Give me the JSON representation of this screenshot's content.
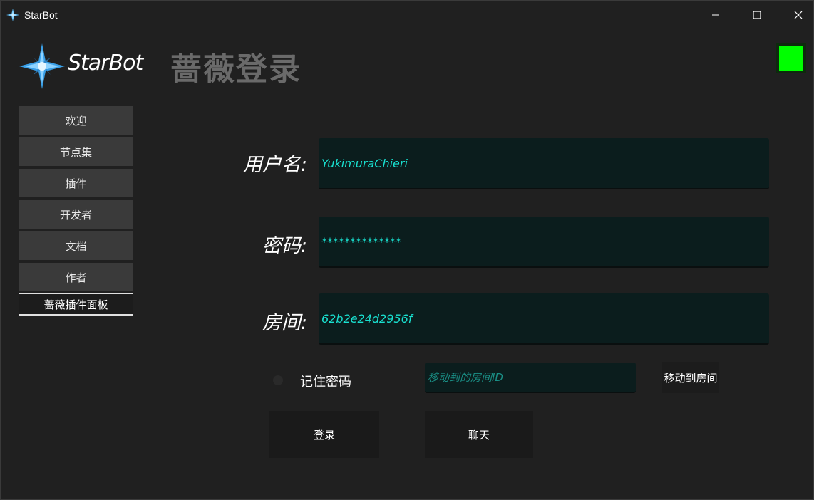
{
  "window": {
    "title": "StarBot",
    "icon": "starbot-icon",
    "controls": [
      "minimize-icon",
      "maximize-icon",
      "close-icon"
    ]
  },
  "sidebar": {
    "logo_text": "StarBot",
    "items": [
      {
        "label": "欢迎"
      },
      {
        "label": "节点集"
      },
      {
        "label": "插件"
      },
      {
        "label": "开发者"
      },
      {
        "label": "文档"
      },
      {
        "label": "作者"
      },
      {
        "label": "蔷薇插件面板",
        "active": true
      }
    ]
  },
  "main": {
    "title": "蔷薇登录",
    "status_color": "#00ff00",
    "fields": {
      "username": {
        "label": "用户名:",
        "value": "YukimuraChieri"
      },
      "password": {
        "label": "密码:",
        "value": "**************"
      },
      "room": {
        "label": "房间:",
        "value": "62b2e24d2956f"
      }
    },
    "remember_label": "记住密码",
    "move_room_placeholder": "移动到的房间ID",
    "move_button": "移动到房间",
    "login_button": "登录",
    "chat_button": "聊天"
  },
  "colors": {
    "accent_text": "#19e0d0",
    "input_bg": "#0b1d1d",
    "status": "#00ff00"
  }
}
